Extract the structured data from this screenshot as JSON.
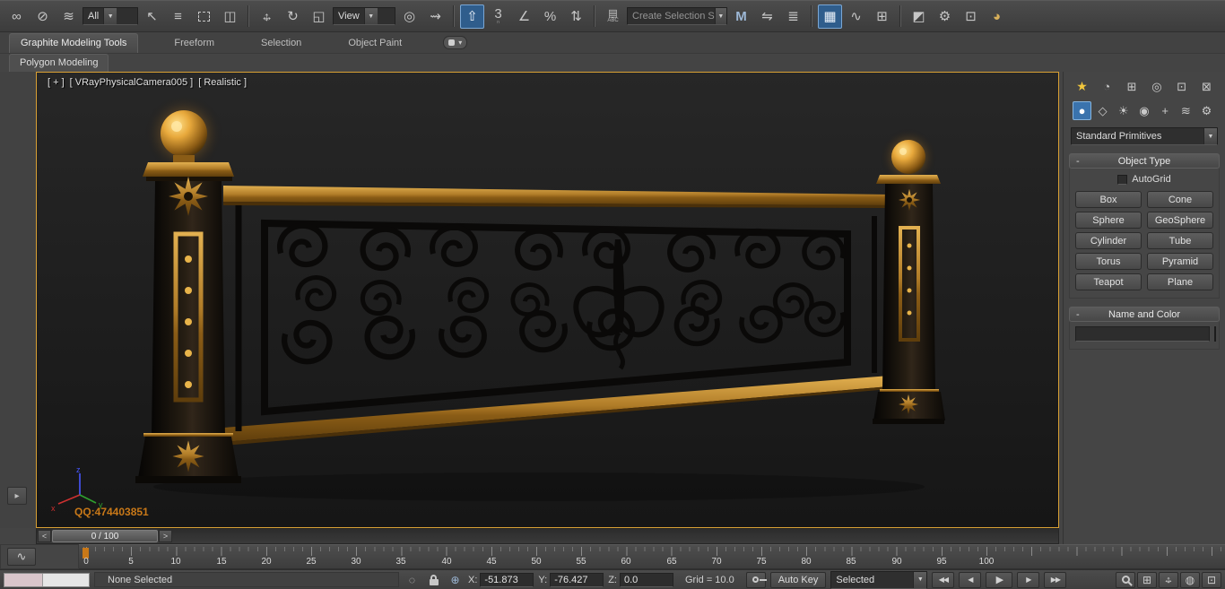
{
  "colors": {
    "accent": "#d9a033",
    "pressed": "#2f5d8c",
    "pressed_border": "#7ba7d4",
    "swatch": "#df2f96",
    "watermark": "#c87818",
    "gold": "#c8913a"
  },
  "icons": {
    "link": "∞",
    "unlink": "⊘",
    "bind_warp": "≋",
    "select": "↖",
    "by_name": "≡",
    "crossing": "◫",
    "arrow_h": "↔",
    "arrow_v": "↕",
    "rotate": "↻",
    "scale": "◱",
    "pivot": "◎",
    "manipulate": "⇝",
    "keyboard": "⇧",
    "snaps": "3",
    "snaps_sub": "∩",
    "angle": "∠",
    "percent": "%",
    "spinner": "⇅",
    "named_sets": "▤",
    "named_sets_sub": "ABC",
    "mirror": "M",
    "align": "⇋",
    "layers": "≣",
    "ribbon_toggle": "▦",
    "curve_editor": "∿",
    "schematic": "⊞",
    "material": "◩",
    "render_setup": "⚙",
    "rendered_frame": "⊡",
    "render": "◕",
    "combo_arrow": "▼",
    "ribbon_options": "▾",
    "create_tab": "★",
    "modify_tab": "◔",
    "hierarchy_tab": "⊞",
    "motion_tab": "◎",
    "display_tab": "⊡",
    "utilities_tab": "⊠",
    "geometry": "●",
    "shapes": "◇",
    "lights": "☀",
    "cameras": "◉",
    "helpers": "+",
    "space_warps": "≋",
    "systems": "⚙",
    "isolate": "◌",
    "absmode": "⊕",
    "play_start": "◀◀",
    "play_prev": "◀",
    "play": "▶",
    "play_next": "▶",
    "play_end": "▶▶",
    "zoom_extents": "⊞",
    "orbit": "◍",
    "maximize": "⊡",
    "strip_arrow": "▸",
    "mini_curve": "∿"
  },
  "toolbar": {
    "filter_combo": "All",
    "coord_combo": "View",
    "selection_set_combo": "Create Selection Se"
  },
  "ribbon": {
    "tabs": [
      "Graphite Modeling Tools",
      "Freeform",
      "Selection",
      "Object Paint"
    ],
    "subtab": "Polygon Modeling"
  },
  "viewport": {
    "menu_plus": "[ + ]",
    "menu_camera": "[ VRayPhysicalCamera005 ]",
    "menu_shading": "[ Realistic ]",
    "watermark": "QQ:474403851",
    "axis_x": "x",
    "axis_y": "y",
    "axis_z": "z"
  },
  "command_panel": {
    "primitives_combo": "Standard Primitives",
    "object_type": {
      "collapse": "-",
      "title": "Object Type",
      "autogrid": "AutoGrid",
      "buttons": [
        "Box",
        "Cone",
        "Sphere",
        "GeoSphere",
        "Cylinder",
        "Tube",
        "Torus",
        "Pyramid",
        "Teapot",
        "Plane"
      ]
    },
    "name_color": {
      "collapse": "-",
      "title": "Name and Color",
      "name_value": ""
    }
  },
  "timeline": {
    "prev": "<",
    "next": ">",
    "slider": "0 / 100",
    "ticks": [
      "0",
      "5",
      "10",
      "15",
      "20",
      "25",
      "30",
      "35",
      "40",
      "45",
      "50",
      "55",
      "60",
      "65",
      "70",
      "75",
      "80",
      "85",
      "90",
      "95",
      "100"
    ]
  },
  "status": {
    "prompt": "None Selected",
    "x_label": "X:",
    "x_value": "-51.873",
    "y_label": "Y:",
    "y_value": "-76.427",
    "z_label": "Z:",
    "z_value": "0.0",
    "grid": "Grid = 10.0",
    "auto_key": "Auto Key",
    "key_filter": "Selected"
  }
}
